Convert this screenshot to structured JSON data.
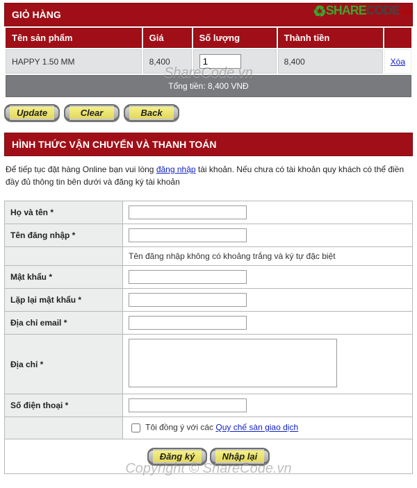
{
  "brand": {
    "share": "SHARE",
    "code": "CODE",
    "suffix": ".vn"
  },
  "watermark": "ShareCode.vn",
  "copyright": "Copyright © ShareCode.vn",
  "cart": {
    "title": "GIỎ HÀNG",
    "headers": {
      "name": "Tên sản phẩm",
      "price": "Giá",
      "qty": "Số lượng",
      "total": "Thành tiền"
    },
    "row": {
      "name": "HAPPY 1.50 MM",
      "price": "8,400",
      "qty": "1",
      "total": "8,400",
      "del": "Xóa"
    },
    "sumline": "Tổng tiền: 8,400 VNĐ",
    "buttons": {
      "update": "Update",
      "clear": "Clear",
      "back": "Back"
    }
  },
  "ship": {
    "title": "HÌNH THỨC VẬN CHUYỂN VÀ THANH TOÁN",
    "intro_a": "Để tiếp tục đặt hàng Online bạn vui lòng ",
    "intro_link": "đăng nhập",
    "intro_b": " tài khoản. Nếu chưa có tài khoản quy khách có thể điền đầy đủ thông tin bên dưới và đăng ký tài khoản",
    "labels": {
      "fullname": "Họ và tên *",
      "username": "Tên đăng nhập *",
      "username_hint": "Tên đăng nhập không có khoảng trắng và ký tự đặc biệt",
      "pass": "Mật khẩu *",
      "pass2": "Lặp lại mật khẩu *",
      "email": "Địa chỉ email *",
      "address": "Địa chỉ *",
      "phone": "Số điện thoại *",
      "agree_a": "Tôi đồng ý với các ",
      "agree_link": "Quy chế sàn giao dịch"
    },
    "buttons": {
      "reg": "Đăng ký",
      "retype": "Nhập lại"
    }
  }
}
